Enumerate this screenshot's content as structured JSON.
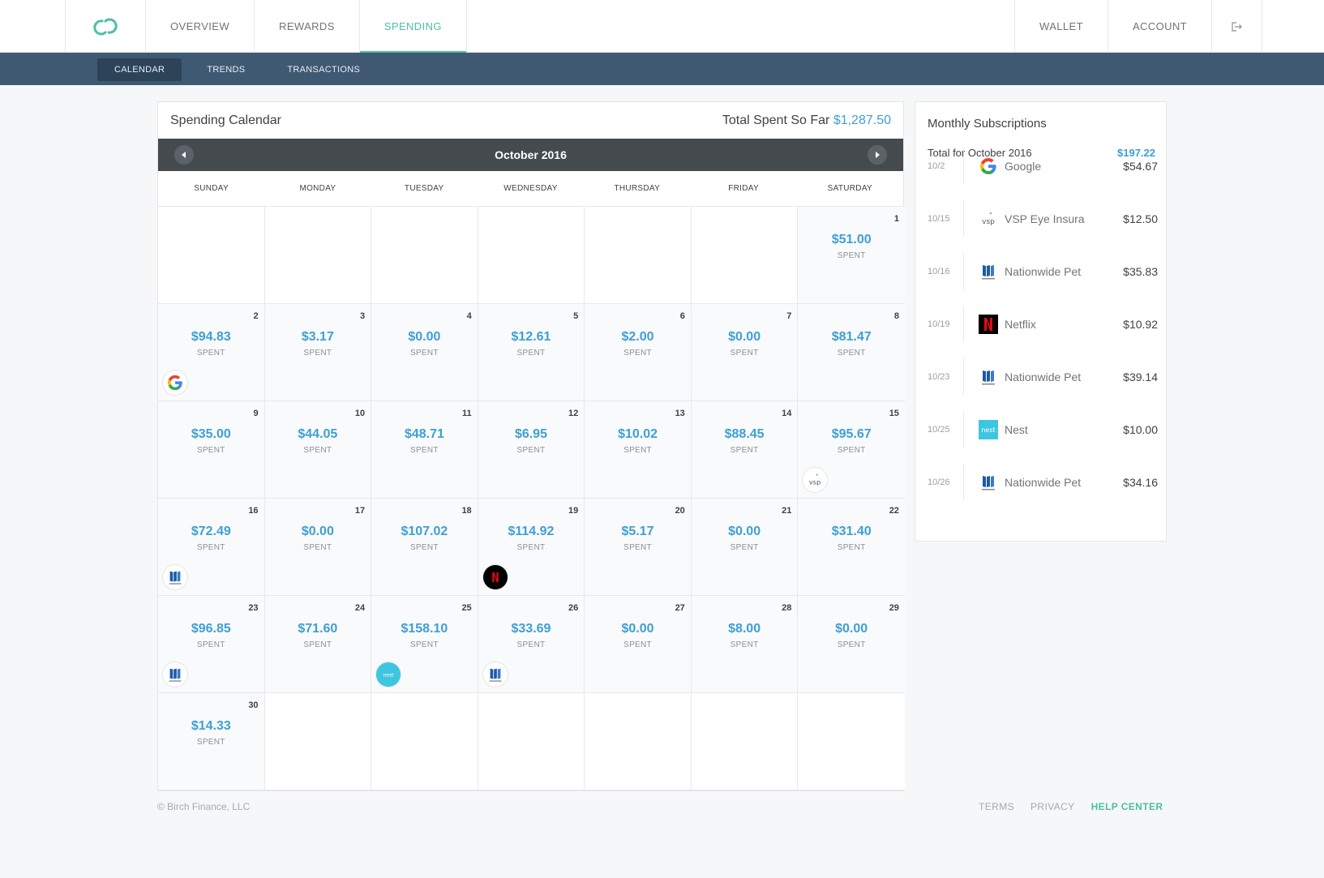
{
  "nav": {
    "left": [
      "OVERVIEW",
      "REWARDS",
      "SPENDING"
    ],
    "right": [
      "WALLET",
      "ACCOUNT"
    ],
    "active": "SPENDING"
  },
  "subnav": [
    "CALENDAR",
    "TRENDS",
    "TRANSACTIONS"
  ],
  "calendar": {
    "title": "Spending Calendar",
    "total_label": "Total Spent So Far",
    "total_value": "$1,287.50",
    "month": "October 2016",
    "weekdays": [
      "SUNDAY",
      "MONDAY",
      "TUESDAY",
      "WEDNESDAY",
      "THURSDAY",
      "FRIDAY",
      "SATURDAY"
    ],
    "spent_label": "SPENT",
    "leading_blanks": 6,
    "days": [
      {
        "day": "1",
        "amount": "$51.00"
      },
      {
        "day": "2",
        "amount": "$94.83",
        "icon": "google"
      },
      {
        "day": "3",
        "amount": "$3.17"
      },
      {
        "day": "4",
        "amount": "$0.00"
      },
      {
        "day": "5",
        "amount": "$12.61"
      },
      {
        "day": "6",
        "amount": "$2.00"
      },
      {
        "day": "7",
        "amount": "$0.00"
      },
      {
        "day": "8",
        "amount": "$81.47"
      },
      {
        "day": "9",
        "amount": "$35.00"
      },
      {
        "day": "10",
        "amount": "$44.05"
      },
      {
        "day": "11",
        "amount": "$48.71"
      },
      {
        "day": "12",
        "amount": "$6.95"
      },
      {
        "day": "13",
        "amount": "$10.02"
      },
      {
        "day": "14",
        "amount": "$88.45"
      },
      {
        "day": "15",
        "amount": "$95.67",
        "icon": "vsp"
      },
      {
        "day": "16",
        "amount": "$72.49",
        "icon": "nationwide"
      },
      {
        "day": "17",
        "amount": "$0.00"
      },
      {
        "day": "18",
        "amount": "$107.02"
      },
      {
        "day": "19",
        "amount": "$114.92",
        "icon": "netflix"
      },
      {
        "day": "20",
        "amount": "$5.17"
      },
      {
        "day": "21",
        "amount": "$0.00"
      },
      {
        "day": "22",
        "amount": "$31.40"
      },
      {
        "day": "23",
        "amount": "$96.85",
        "icon": "nationwide"
      },
      {
        "day": "24",
        "amount": "$71.60"
      },
      {
        "day": "25",
        "amount": "$158.10",
        "icon": "nest"
      },
      {
        "day": "26",
        "amount": "$33.69",
        "icon": "nationwide"
      },
      {
        "day": "27",
        "amount": "$0.00"
      },
      {
        "day": "28",
        "amount": "$8.00"
      },
      {
        "day": "29",
        "amount": "$0.00"
      },
      {
        "day": "30",
        "amount": "$14.33"
      }
    ],
    "trailing_blanks": 6
  },
  "subscriptions": {
    "title": "Monthly Subscriptions",
    "total_label": "Total for October 2016",
    "total_value": "$197.22",
    "items": [
      {
        "date": "10/2",
        "name": "Google",
        "amount": "$54.67",
        "icon": "google"
      },
      {
        "date": "10/15",
        "name": "VSP Eye Insura",
        "amount": "$12.50",
        "icon": "vsp"
      },
      {
        "date": "10/16",
        "name": "Nationwide Pet",
        "amount": "$35.83",
        "icon": "nationwide"
      },
      {
        "date": "10/19",
        "name": "Netflix",
        "amount": "$10.92",
        "icon": "netflix"
      },
      {
        "date": "10/23",
        "name": "Nationwide Pet",
        "amount": "$39.14",
        "icon": "nationwide"
      },
      {
        "date": "10/25",
        "name": "Nest",
        "amount": "$10.00",
        "icon": "nest"
      },
      {
        "date": "10/26",
        "name": "Nationwide Pet",
        "amount": "$34.16",
        "icon": "nationwide"
      }
    ]
  },
  "footer": {
    "copyright": "© Birch Finance, LLC",
    "links": [
      "TERMS",
      "PRIVACY",
      "HELP CENTER"
    ]
  },
  "colors": {
    "accent": "#4dbfa4",
    "amount_blue": "#3e9fd5",
    "subnav_bg": "#3f5973"
  }
}
